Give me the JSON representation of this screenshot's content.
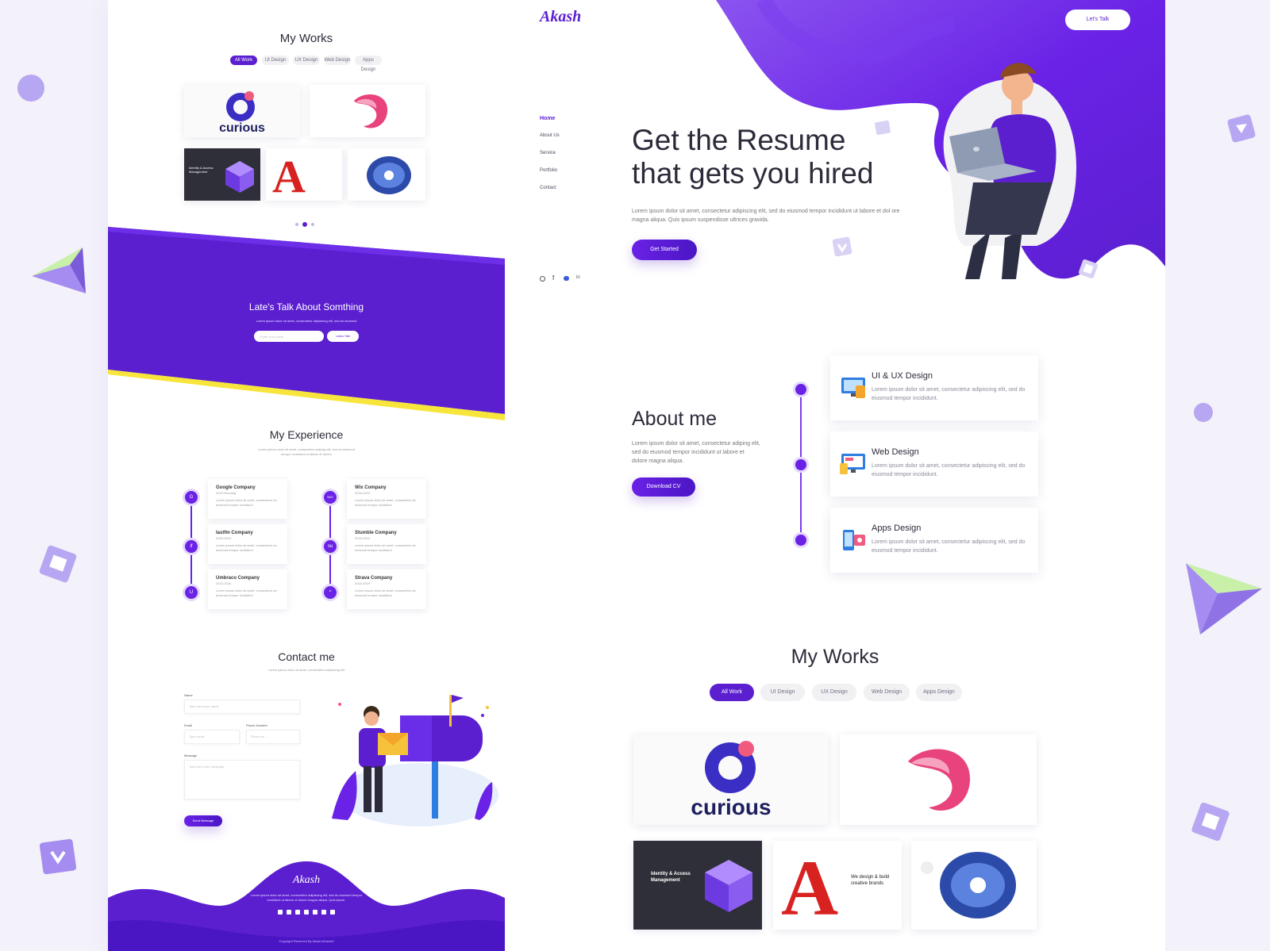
{
  "left": {
    "works": {
      "title": "My Works",
      "filters": [
        "All Work",
        "UI Design",
        "UX Design",
        "Web Design",
        "Apps Design"
      ]
    },
    "talk": {
      "title": "Late's Talk About Somthing",
      "subtitle": "Lorem ipsum dolor sit amet, consectetur adipiscing elit, sed do eiusmod",
      "placeholder": "Enter your email",
      "button": "Lates Talk"
    },
    "experience": {
      "title": "My Experience",
      "subtitle": "Lorem ipsum dolor sit amet, consectetur adiping elit, sed do eiusmod tempor incididunt ut labore et dolore",
      "items": [
        {
          "company": "Google Company",
          "dates": "2019-Running",
          "text": "Lorem ipsum dolor sit amet, consectetur do eiusmod tempor incididunt",
          "icon": "G"
        },
        {
          "company": "lastfm Company",
          "dates": "2016-2019",
          "text": "Lorem ipsum dolor sit amet, consectetur do eiusmod tempor incididunt",
          "icon": "lf"
        },
        {
          "company": "Umbraco Company",
          "dates": "2013-2016",
          "text": "Lorem ipsum dolor sit amet, consectetur do eiusmod tempor incididunt",
          "icon": "U"
        },
        {
          "company": "Wix Company",
          "dates": "2016-2019",
          "text": "Lorem ipsum dolor sit amet, consectetur do eiusmod tempor incididunt",
          "icon": "WIX"
        },
        {
          "company": "Stumble Company",
          "dates": "2016-2019",
          "text": "Lorem ipsum dolor sit amet, consectetur do eiusmod tempor incididunt",
          "icon": "su"
        },
        {
          "company": "Strava Company",
          "dates": "2016-2019",
          "text": "Lorem ipsum dolor sit amet, consectetur do eiusmod tempor incididunt",
          "icon": "^"
        }
      ]
    },
    "contact": {
      "title": "Contact me",
      "subtitle": "Lorem ipsum dolor sit amet, consectetur adipiscing elit",
      "name_label": "Name",
      "name_placeholder": "Type here your name",
      "email_label": "Email",
      "email_placeholder": "Type email",
      "phone_label": "Phone Number",
      "phone_placeholder": "Phone no",
      "message_label": "Message",
      "message_placeholder": "Type here your message",
      "button": "Send Message"
    },
    "footer": {
      "logo": "Akash",
      "text": "Lorem ipsum dolor sit amet, consectetur adipiscing elit, sed do eiusmod tempor incididunt ut labore et dolore magna aliqua. Quis ipsum.",
      "copyright": "Copyright Reserved By Akash Ahamed"
    }
  },
  "right": {
    "logo": "Akash",
    "cta_button": "Let's Talk",
    "nav": [
      "Home",
      "About Us",
      "Service",
      "Portfolio",
      "Contact"
    ],
    "hero": {
      "title_line1": "Get the Resume",
      "title_line2": "that gets you hired",
      "text": "Lorem ipsum dolor sit amet, consectetur adipiscing elit, sed do eiusmod tempor incididunt ut labore et dol ore magna aliqua. Quis ipsum suspendisse ultrices gravida.",
      "button": "Get Started"
    },
    "about": {
      "title": "About me",
      "text": "Lorem ipsum dolor sit amet, consectetur adiping elit, sed do eiusmod tempor incididunt ut labore et dolore magna aliqua.",
      "button": "Download CV"
    },
    "services": [
      {
        "title": "UI & UX Design",
        "text": "Lorem ipsum dolor sit amet, consectetur adipiscing elit, sed do eiusmod tempor incididunt."
      },
      {
        "title": "Web Design",
        "text": "Lorem ipsum dolor sit amet, consectetur adipiscing elit, sed do eiusmod tempor incididunt."
      },
      {
        "title": "Apps Design",
        "text": "Lorem ipsum dolor sit amet, consectetur adipiscing elit, sed do eiusmod tempor incididunt."
      }
    ],
    "works": {
      "title": "My Works",
      "filters": [
        "All Work",
        "UI Design",
        "UX Design",
        "Web Design",
        "Apps Design"
      ],
      "thumb_curious": "curious",
      "thumb_identity": "Identity & Access Management",
      "thumb_brands": "We design & build creative brands"
    }
  },
  "colors": {
    "accent": "#5b1fd0",
    "accent_light": "#8b54f0",
    "yellow": "#f7e53b"
  }
}
